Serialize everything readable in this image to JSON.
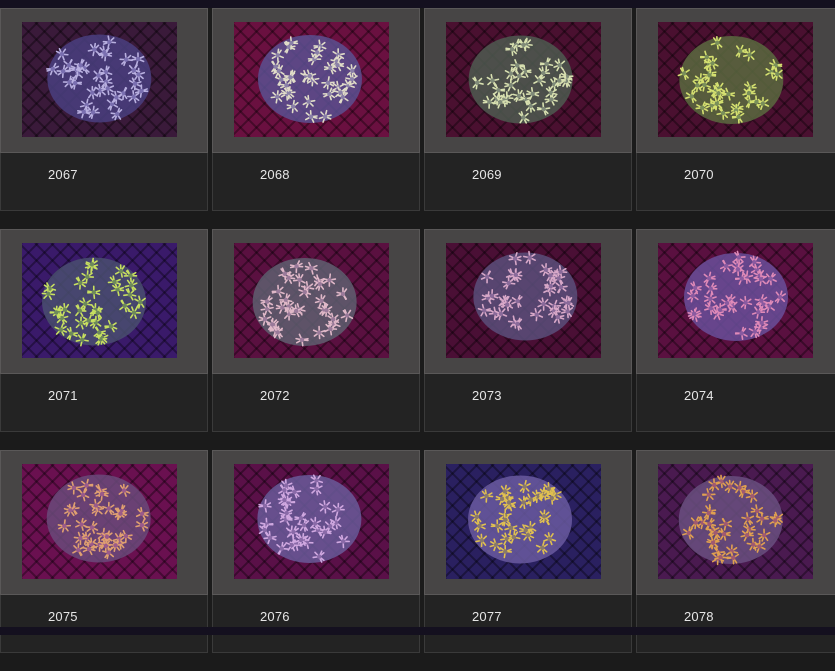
{
  "gallery": {
    "items": [
      {
        "label": "2067",
        "bg": "#3a1a3a",
        "coral": "#7a6fb0",
        "tip": "#b9b0e0",
        "center": "#4a3f80"
      },
      {
        "label": "2068",
        "bg": "#6a1040",
        "coral": "#8a80a8",
        "tip": "#e0dcc8",
        "center": "#5a5090"
      },
      {
        "label": "2069",
        "bg": "#4a1030",
        "coral": "#7f8a78",
        "tip": "#d8e0b0",
        "center": "#4d5a50"
      },
      {
        "label": "2070",
        "bg": "#4a1030",
        "coral": "#7a8f5a",
        "tip": "#d5e070",
        "center": "#5a6a40"
      },
      {
        "label": "2071",
        "bg": "#3a1a6a",
        "coral": "#6e8a5a",
        "tip": "#c8e060",
        "center": "#4a4f70"
      },
      {
        "label": "2072",
        "bg": "#5a1040",
        "coral": "#9a7a9a",
        "tip": "#e0b8c8",
        "center": "#5f5f70"
      },
      {
        "label": "2073",
        "bg": "#4a0f35",
        "coral": "#8a6a9a",
        "tip": "#d8a8c8",
        "center": "#5a4f7a"
      },
      {
        "label": "2074",
        "bg": "#5a1040",
        "coral": "#8a5aa0",
        "tip": "#e08ab8",
        "center": "#6a4f9a"
      },
      {
        "label": "2075",
        "bg": "#6a1050",
        "coral": "#9a5a8a",
        "tip": "#e0a070",
        "center": "#6a4a7a"
      },
      {
        "label": "2076",
        "bg": "#5a1048",
        "coral": "#8a6aa8",
        "tip": "#d0a8e0",
        "center": "#6a5a9a"
      },
      {
        "label": "2077",
        "bg": "#2a2060",
        "coral": "#8a7a6a",
        "tip": "#e0c050",
        "center": "#6a5aa0"
      },
      {
        "label": "2078",
        "bg": "#4a1a50",
        "coral": "#a05a70",
        "tip": "#e0a050",
        "center": "#6a5080"
      }
    ]
  }
}
